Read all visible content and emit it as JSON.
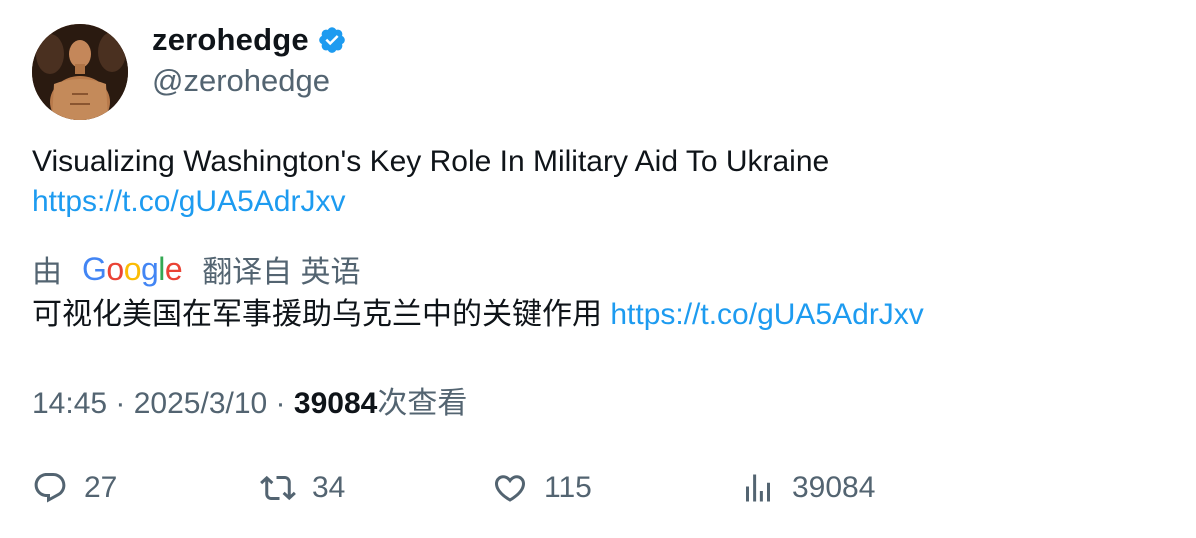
{
  "author": {
    "display_name": "zerohedge",
    "handle": "@zerohedge",
    "verified_color": "#1d9bf0"
  },
  "tweet": {
    "text": "Visualizing Washington's Key Role In Military Aid To Ukraine",
    "link": "https://t.co/gUA5AdrJxv"
  },
  "translation": {
    "prefix": "由",
    "provider_logo_text": "Google",
    "suffix": "翻译自 英语",
    "text": "可视化美国在军事援助乌克兰中的关键作用",
    "link": "https://t.co/gUA5AdrJxv"
  },
  "meta": {
    "time": "14:45",
    "sep1": " · ",
    "date": "2025/3/10",
    "sep2": " · ",
    "views_count": "39084",
    "views_suffix": "次查看"
  },
  "actions": {
    "reply_count": "27",
    "retweet_count": "34",
    "like_count": "115",
    "views_count": "39084"
  },
  "colors": {
    "link": "#1d9bf0",
    "secondary_text": "#536471",
    "primary_text": "#0f1419"
  }
}
